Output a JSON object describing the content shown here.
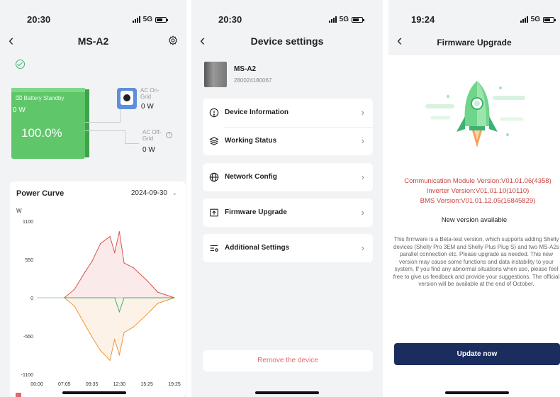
{
  "screen1": {
    "status": {
      "time": "20:30",
      "network": "5G"
    },
    "title": "MS-A2",
    "battery": {
      "state": "Battery Standby",
      "power": "0 W",
      "soc": "100.0%"
    },
    "on_grid": {
      "label": "AC On-\nGrid",
      "power": "0 W"
    },
    "off_grid": {
      "label": "AC Off-\nGrid",
      "power": "0 W"
    },
    "power_curve": {
      "title": "Power Curve",
      "date": "2024-09-30"
    }
  },
  "chart_data": {
    "type": "line",
    "title": "Power Curve",
    "ylabel": "W",
    "xlabel": "",
    "ylim": [
      -1100,
      1100
    ],
    "yticks": [
      "1100",
      "550",
      "0",
      "-550",
      "-1100"
    ],
    "xticks": [
      "00:00",
      "07:05",
      "09:35",
      "12:30",
      "15:25",
      "19:25"
    ],
    "x": [
      "07:05",
      "08:00",
      "09:00",
      "09:35",
      "10:30",
      "11:30",
      "12:00",
      "12:30",
      "13:00",
      "14:00",
      "15:25",
      "17:00",
      "19:25"
    ],
    "series": [
      {
        "color": "#d9534f",
        "values": [
          0,
          120,
          380,
          520,
          780,
          880,
          650,
          950,
          500,
          430,
          250,
          80,
          0
        ]
      },
      {
        "color": "#e8963c",
        "values": [
          0,
          -120,
          -400,
          -560,
          -760,
          -900,
          -600,
          -820,
          -500,
          -420,
          -240,
          -80,
          0
        ]
      },
      {
        "color": "#3bb273",
        "values": [
          0,
          0,
          0,
          0,
          0,
          0,
          0,
          -200,
          0,
          0,
          0,
          0,
          0
        ]
      }
    ],
    "grid": false
  },
  "screen2": {
    "status": {
      "time": "20:30",
      "network": "5G"
    },
    "title": "Device settings",
    "device": {
      "name": "MS-A2",
      "serial": "280024180067"
    },
    "menu": [
      {
        "label": "Device Information",
        "icon": "info-icon"
      },
      {
        "label": "Working Status",
        "icon": "layers-icon"
      },
      {
        "label": "Network Config",
        "icon": "globe-icon"
      },
      {
        "label": "Firmware Upgrade",
        "icon": "upload-icon"
      },
      {
        "label": "Additional Settings",
        "icon": "settings-lines-icon"
      }
    ],
    "remove_label": "Remove the device"
  },
  "screen3": {
    "status": {
      "time": "19:24",
      "network": "5G"
    },
    "title": "Firmware Upgrade",
    "versions": [
      "Communication Module Version:V01.01.06(4358)",
      "Inverter Version:V01.01.10(10110)",
      "BMS Version:V01.01.12.05(16845829)"
    ],
    "new_version": "New version available",
    "description": "This firmware is a Beta-test version, which supports adding Shelly devices (Shelly Pro 3EM and Shelly Plus Plug S) and two MS-A2s parallel connection etc. Please upgrade as needed. This new version may cause some functions and data instability to your system. If you find any abnormal situations when use, please feel free to give us feedback and provide your suggestions. The official version will be available at the end of October.",
    "update_label": "Update now"
  },
  "colors": {
    "battery_green": "#5fc76a",
    "accent_navy": "#1b2d5e",
    "warning_red": "#c9443f"
  }
}
